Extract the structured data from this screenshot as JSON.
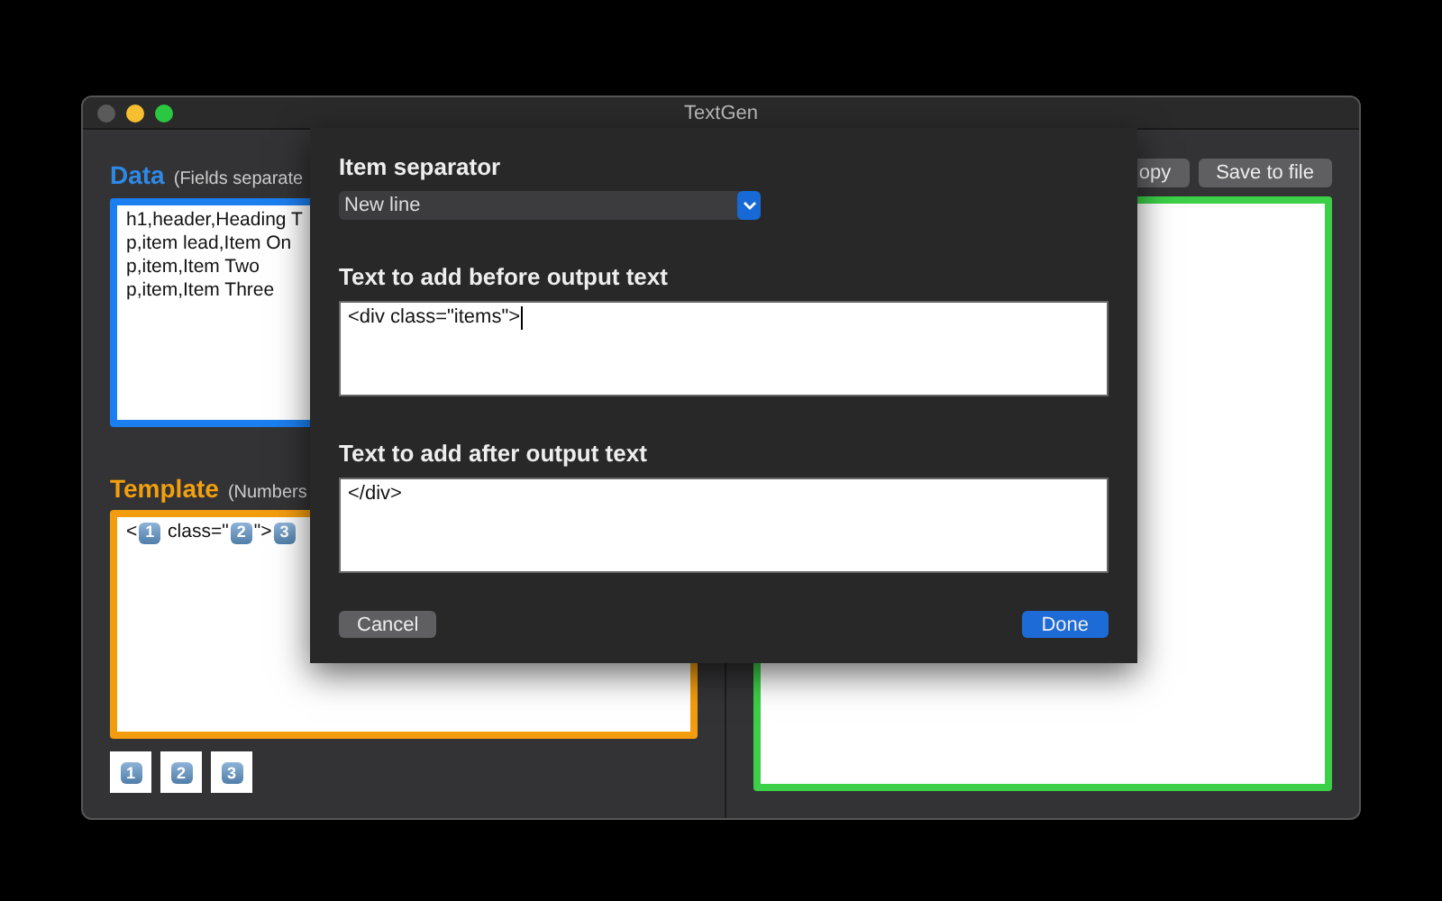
{
  "window": {
    "title": "TextGen"
  },
  "data_panel": {
    "label": "Data",
    "hint": "(Fields separate",
    "lines": [
      "h1,header,Heading T",
      "p,item lead,Item On",
      "p,item,Item Two",
      "p,item,Item Three"
    ]
  },
  "template_panel": {
    "label": "Template",
    "hint": "(Numbers",
    "tokens": [
      {
        "kind": "text",
        "text": "<"
      },
      {
        "kind": "field",
        "text": "1"
      },
      {
        "kind": "text",
        "text": " class=\""
      },
      {
        "kind": "field",
        "text": "2"
      },
      {
        "kind": "text",
        "text": "\">"
      },
      {
        "kind": "field",
        "text": "3"
      }
    ]
  },
  "field_buttons": [
    "1",
    "2",
    "3"
  ],
  "output_panel": {
    "buttons": [
      "opy",
      "Save to file"
    ]
  },
  "sheet": {
    "separator": {
      "label": "Item separator",
      "value": "New line"
    },
    "before": {
      "label": "Text to add before output text",
      "value": "<div class=\"items\">",
      "focused": true
    },
    "after": {
      "label": "Text to add after output text",
      "value": "</div>",
      "focused": false
    },
    "buttons": [
      {
        "label": "Cancel",
        "kind": "secondary"
      },
      {
        "label": "Done",
        "kind": "primary"
      }
    ]
  }
}
